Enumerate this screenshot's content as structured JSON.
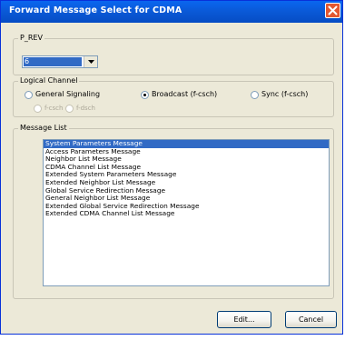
{
  "window": {
    "title": "Forward Message Select for CDMA"
  },
  "p_rev": {
    "group_label": "P_REV",
    "selected_value": "6"
  },
  "logical_channel": {
    "group_label": "Logical Channel",
    "options": [
      {
        "label": "General Signaling",
        "checked": false,
        "enabled": true
      },
      {
        "label": "Broadcast (f-csch)",
        "checked": true,
        "enabled": true
      },
      {
        "label": "Sync (f-csch)",
        "checked": false,
        "enabled": true
      }
    ],
    "sub_options": [
      {
        "label": "f-csch",
        "checked": false,
        "enabled": false
      },
      {
        "label": "f-dsch",
        "checked": false,
        "enabled": false
      }
    ]
  },
  "message_list": {
    "group_label": "Message List",
    "items": [
      "System Parameters Message",
      "Access Parameters Message",
      "Neighbor List Message",
      "CDMA Channel List Message",
      "Extended System Parameters Message",
      "Extended Neighbor List Message",
      "Global Service Redirection Message",
      "General Neighbor List Message",
      "Extended Global Service Redirection Message",
      "Extended CDMA Channel List Message"
    ],
    "selected_index": 0
  },
  "buttons": {
    "edit": "Edit...",
    "cancel": "Cancel"
  }
}
